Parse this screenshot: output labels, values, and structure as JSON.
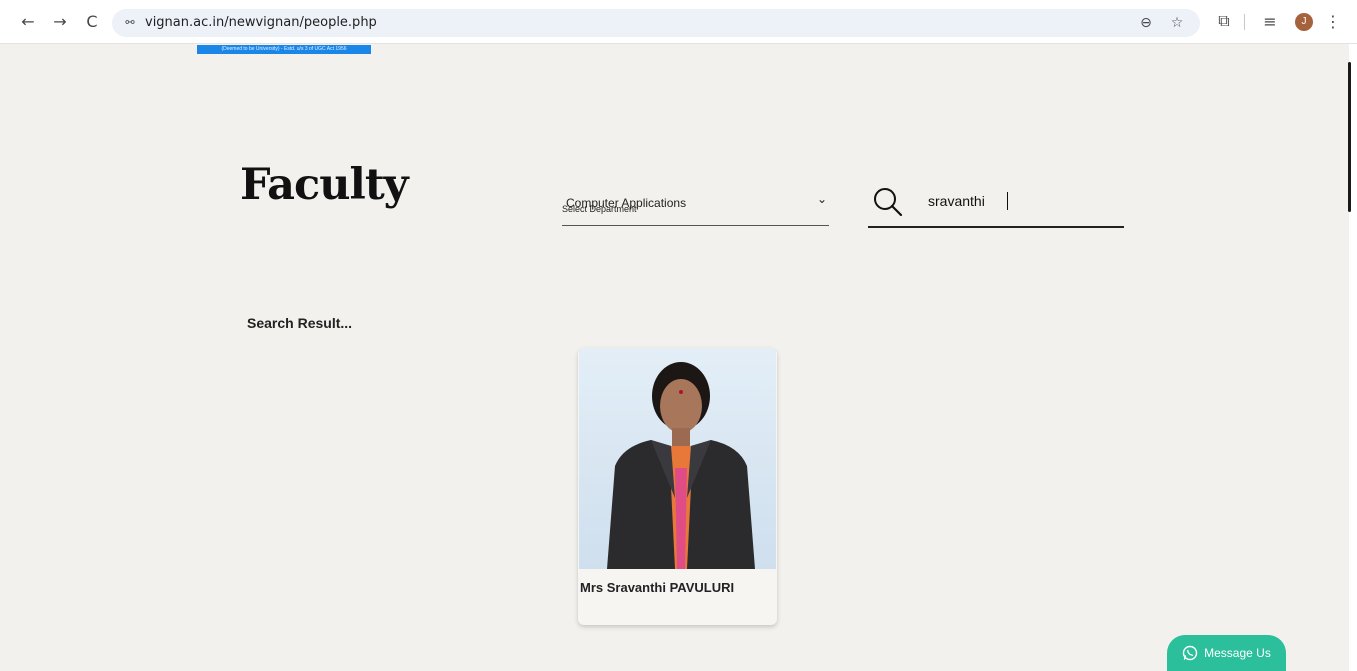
{
  "browser": {
    "url": "vignan.ac.in/newvignan/people.php",
    "back_icon": "←",
    "forward_icon": "→",
    "reload_icon": "C",
    "site_info_icon": "⚯",
    "zoom_icon": "⊖",
    "bookmark_icon": "☆",
    "extensions_icon": "⧉",
    "reading_list_icon": "≡",
    "profile_initial": "J",
    "menu_icon": "⋮"
  },
  "banner": {
    "text": "(Deemed to be University) - Estd. u/s 3 of UGC Act 1956"
  },
  "page": {
    "title": "Faculty"
  },
  "filters": {
    "department_label": "Select Department",
    "department_value": "Computer Applications",
    "chevron": "⌄",
    "search_value": "sravanthi"
  },
  "results": {
    "heading": "Search Result...",
    "items": [
      {
        "name": "Mrs Sravanthi PAVULURI"
      }
    ]
  },
  "chat": {
    "label": "Message Us"
  },
  "colors": {
    "page_bg": "#f2f1ed",
    "chat_button": "#2bbf9b",
    "banner": "#1a86e8"
  }
}
